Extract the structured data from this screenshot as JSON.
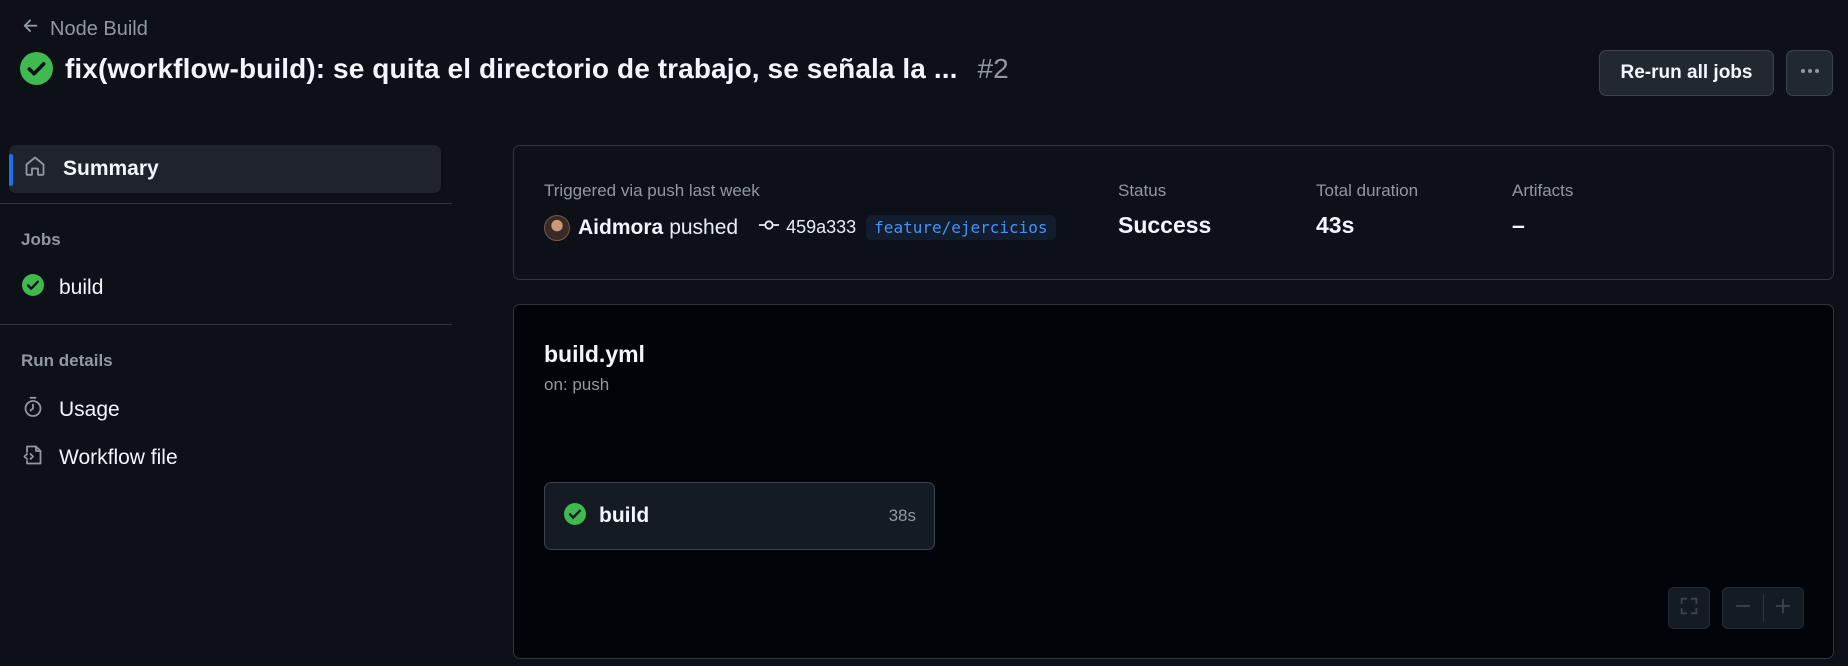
{
  "header": {
    "back_label": "Node Build",
    "title": "fix(workflow-build): se quita el directorio de trabajo, se señala la ...",
    "run_number": "#2",
    "rerun_label": "Re-run all jobs"
  },
  "sidebar": {
    "summary_label": "Summary",
    "jobs_section": "Jobs",
    "jobs": [
      {
        "label": "build",
        "status": "success"
      }
    ],
    "details_section": "Run details",
    "details": [
      {
        "label": "Usage",
        "icon": "stopwatch-icon"
      },
      {
        "label": "Workflow file",
        "icon": "file-code-icon"
      }
    ]
  },
  "summary": {
    "triggered_text": "Triggered via push last week",
    "author": "Aidmora",
    "action": "pushed",
    "commit": "459a333",
    "branch": "feature/ejercicios",
    "status_label": "Status",
    "status_value": "Success",
    "duration_label": "Total duration",
    "duration_value": "43s",
    "artifacts_label": "Artifacts",
    "artifacts_value": "–"
  },
  "workflow": {
    "file": "build.yml",
    "trigger": "on: push",
    "job": {
      "name": "build",
      "duration": "38s"
    }
  },
  "colors": {
    "background": "#0d1117",
    "graph_background": "#010409",
    "success": "#3fb950",
    "accent": "#1f6feb",
    "link": "#4493f8"
  }
}
